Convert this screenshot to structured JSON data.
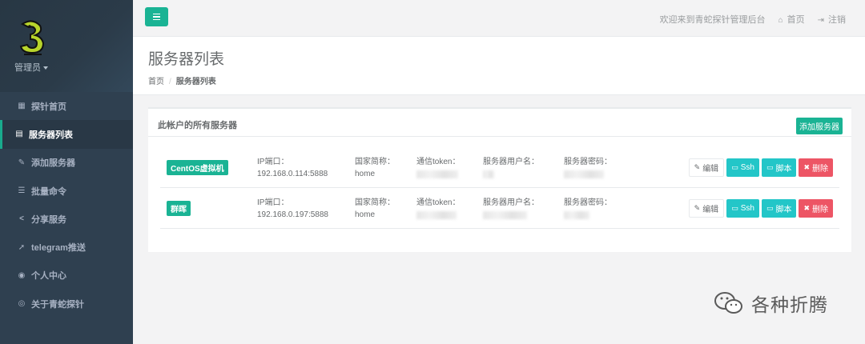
{
  "sidebar": {
    "user": "管理员",
    "items": [
      {
        "label": "探针首页",
        "icon": "▦",
        "active": false
      },
      {
        "label": "服务器列表",
        "icon": "▤",
        "active": true
      },
      {
        "label": "添加服务器",
        "icon": "✎",
        "active": false
      },
      {
        "label": "批量命令",
        "icon": "☰",
        "active": false
      },
      {
        "label": "分享服务",
        "icon": "<",
        "active": false
      },
      {
        "label": "telegram推送",
        "icon": "➚",
        "active": false
      },
      {
        "label": "个人中心",
        "icon": "◉",
        "active": false
      },
      {
        "label": "关于青蛇探针",
        "icon": "◎",
        "active": false
      }
    ]
  },
  "topbar": {
    "welcome": "欢迎来到青蛇探针管理后台",
    "home": "首页",
    "logout": "注销"
  },
  "page": {
    "title": "服务器列表",
    "breadcrumb_home": "首页",
    "breadcrumb_current": "服务器列表"
  },
  "panel": {
    "title": "此帐户的所有服务器",
    "add_button": "添加服务器"
  },
  "columns": {
    "ip": "IP端口：",
    "country": "国家简称：",
    "token": "通信token：",
    "user": "服务器用户名：",
    "password": "服务器密码："
  },
  "servers": [
    {
      "name": "CentOS虚拟机",
      "ip": "192.168.0.114:5888",
      "country": "home"
    },
    {
      "name": "群晖",
      "ip": "192.168.0.197:5888",
      "country": "home"
    }
  ],
  "actions": {
    "edit": "编辑",
    "ssh": "Ssh",
    "script": "脚本",
    "delete": "删除"
  },
  "watermark": "各种折腾",
  "colors": {
    "sidebar": "#2f4050",
    "primary": "#1ab394",
    "info": "#23c6c8",
    "danger": "#ed5565"
  }
}
